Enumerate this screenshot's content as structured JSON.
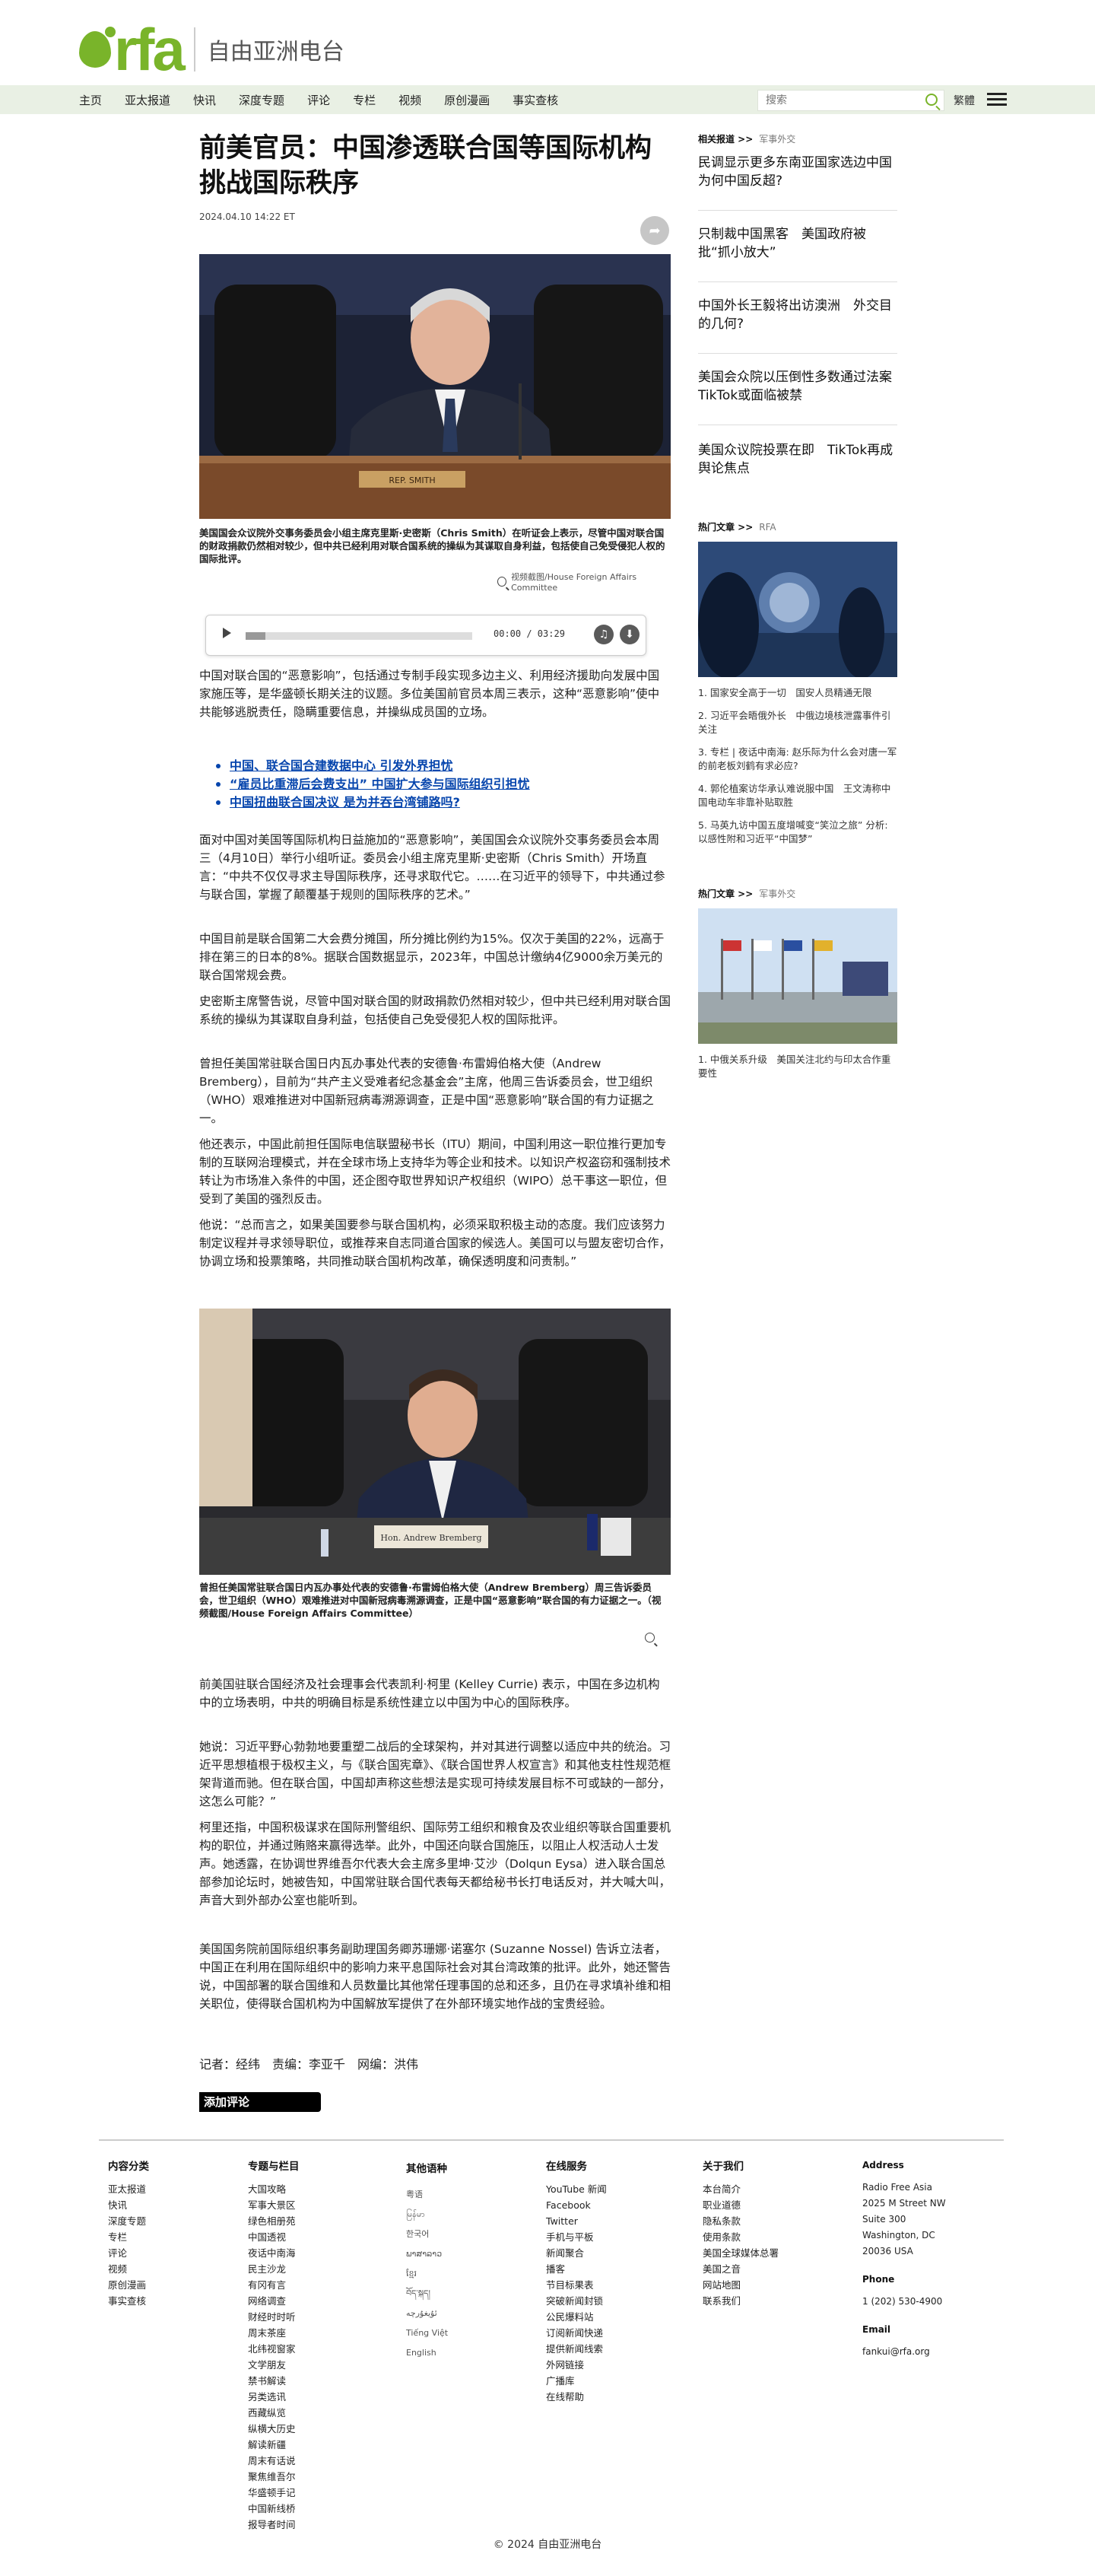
{
  "brand": {
    "logo_text": "rfa",
    "name_cn": "自由亚洲电台",
    "accent": "#79b42a"
  },
  "nav": {
    "items": [
      "主页",
      "亚太报道",
      "快讯",
      "深度专题",
      "评论",
      "专栏",
      "视频",
      "原创漫画",
      "事实查核"
    ],
    "search_placeholder": "搜索",
    "lang_toggle": "繁體"
  },
  "article": {
    "title": "前美官员：中国渗透联合国等国际机构挑战国际秩序",
    "date": "2024.04.10 14:22 ET",
    "photo1": {
      "nameplate": "REP. SMITH",
      "caption": "美国国会众议院外交事务委员会小组主席克里斯·史密斯（Chris Smith）在听证会上表示，尽管中国对联合国的财政捐款仍然相对较少，但中共已经利用对联合国系统的操纵为其谋取自身利益，包括使自己免受侵犯人权的国际批评。",
      "credit": "视频截图/House Foreign Affairs Committee"
    },
    "audio": {
      "time": "00:00 / 03:29"
    },
    "paragraphs1": [
      "中国对联合国的“恶意影响”，包括通过专制手段实现多边主义、利用经济援助向发展中国家施压等，是华盛顿长期关注的议题。多位美国前官员本周三表示，这种“恶意影响”使中共能够逃脱责任，隐瞒重要信息，并操纵成员国的立场。"
    ],
    "related_links": [
      "中国、联合国合建数据中心 引发外界担忧",
      "“雇员比重滞后会费支出” 中国扩大参与国际组织引担忧",
      "中国扭曲联合国决议 是为并吞台湾铺路吗?"
    ],
    "paragraphs2": [
      "面对中国对美国等国际机构日益施加的“恶意影响”，美国国会众议院外交事务委员会本周三（4月10日）举行小组听证。委员会小组主席克里斯·史密斯（Chris Smith）开场直言：“中共不仅仅寻求主导国际秩序，还寻求取代它。……在习近平的领导下，中共通过参与联合国，掌握了颠覆基于规则的国际秩序的艺术。”",
      "中国目前是联合国第二大会费分摊国，所分摊比例约为15%。仅次于美国的22%，远高于排在第三的日本的8%。据联合国数据显示，2023年，中国总计缴纳4亿9000余万美元的联合国常规会费。",
      "史密斯主席警告说，尽管中国对联合国的财政捐款仍然相对较少，但中共已经利用对联合国系统的操纵为其谋取自身利益，包括使自己免受侵犯人权的国际批评。",
      "曾担任美国常驻联合国日内瓦办事处代表的安德鲁·布雷姆伯格大使（Andrew Bremberg），目前为“共产主义受难者纪念基金会”主席，他周三告诉委员会，世卫组织（WHO）艰难推进对中国新冠病毒溯源调查，正是中国“恶意影响”联合国的有力证据之一。",
      "他还表示，中国此前担任国际电信联盟秘书长（ITU）期间，中国利用这一职位推行更加专制的互联网治理模式，并在全球市场上支持华为等企业和技术。以知识产权盗窃和强制技术转让为市场准入条件的中国，还企图夺取世界知识产权组织（WIPO）总干事这一职位，但受到了美国的强烈反击。",
      "他说：“总而言之，如果美国要参与联合国机构，必须采取积极主动的态度。我们应该努力制定议程并寻求领导职位，或推荐来自志同道合国家的候选人。美国可以与盟友密切合作，协调立场和投票策略，共同推动联合国机构改革，确保透明度和问责制。”"
    ],
    "photo2": {
      "nameplate": "Hon. Andrew Bremberg",
      "caption": "曾担任美国常驻联合国日内瓦办事处代表的安德鲁·布雷姆伯格大使（Andrew Bremberg）周三告诉委员会，世卫组织（WHO）艰难推进对中国新冠病毒溯源调查，正是中国“恶意影响”联合国的有力证据之一。（视频截图/House Foreign Affairs Committee）"
    },
    "paragraphs3": [
      "前美国驻联合国经济及社会理事会代表凯利·柯里 (Kelley Currie) 表示，中国在多边机构中的立场表明，中共的明确目标是系统性建立以中国为中心的国际秩序。",
      "她说：习近平野心勃勃地要重塑二战后的全球架构，并对其进行调整以适应中共的统治。习近平思想植根于极权主义，与《联合国宪章》、《联合国世界人权宣言》和其他支柱性规范框架背道而驰。但在联合国，中国却声称这些想法是实现可持续发展目标不可或缺的一部分，这怎么可能？”",
      "柯里还指，中国积极谋求在国际刑警组织、国际劳工组织和粮食及农业组织等联合国重要机构的职位，并通过贿赂来赢得选举。此外，中国还向联合国施压，以阻止人权活动人士发声。她透露，在协调世界维吾尔代表大会主席多里坤·艾沙（Dolqun Eysa）进入联合国总部参加论坛时，她被告知，中国常驻联合国代表每天都给秘书长打电话反对，并大喊大叫，声音大到外部办公室也能听到。",
      "美国国务院前国际组织事务副助理国务卿苏珊娜·诺塞尔 (Suzanne Nossel) 告诉立法者，中国正在利用在国际组织中的影响力来平息国际社会对其台湾政策的批评。此外，她还警告说，中国部署的联合国维和人员数量比其他常任理事国的总和还多，且仍在寻求填补维和相关职位，使得联合国机构为中国解放军提供了在外部环境实地作战的宝贵经验。"
    ],
    "byline": "记者：经纬　责编：李亚千　网编：洪伟",
    "add_comment": "添加评论"
  },
  "sidebar": {
    "related_title": "相关报道 >>",
    "related_sub": "军事外交",
    "related_items": [
      "民调显示更多东南亚国家选边中国　为何中国反超?",
      "只制裁中国黑客　美国政府被批“抓小放大”",
      "中国外长王毅将出访澳洲　外交目的几何?",
      "美国会众院以压倒性多数通过法案　TikTok或面临被禁",
      "美国众议院投票在即　TikTok再成舆论焦点"
    ],
    "hot1_title": "热门文章 >>",
    "hot1_sub": "RFA",
    "hot1_items": [
      "1. 国家安全高于一切　国安人员精通无限",
      "2. 习近平会晤俄外长　中俄边境核泄露事件引关注",
      "3. 专栏 | 夜话中南海: 赵乐际为什么会对唐一军的前老板刘鹤有求必应?",
      "4. 郭伦植案访华承认难说服中国　王文涛称中国电动车非靠补贴取胜",
      "5. 马英九访中国五度增喊变“笑泣之旅” 分析: 以感性附和习近平“中国梦”"
    ],
    "hot2_title": "热门文章 >>",
    "hot2_sub": "军事外交",
    "hot2_items": [
      "1. 中俄关系升级　美国关注北约与印太合作重要性"
    ]
  },
  "footer": {
    "columns": [
      {
        "title": "内容分类",
        "items": [
          "亚太报道",
          "快讯",
          "深度专题",
          "专栏",
          "评论",
          "视频",
          "原创漫画",
          "事实查核"
        ]
      },
      {
        "title": "专题与栏目",
        "items": [
          "大国攻略",
          "军事大景区",
          "绿色相册苑",
          "中国透视",
          "夜话中南海",
          "民主沙龙",
          "有冈有言",
          "网络调查",
          "财经时时听",
          "周末茶座",
          "北纬视窗家",
          "文学朋友",
          "禁书解读",
          "另类选讯",
          "西藏纵览",
          "纵横大历史",
          "解读新疆",
          "周末有话说",
          "聚焦维吾尔",
          "华盛顿手记",
          "中国新线桥",
          "报导者时间"
        ]
      },
      {
        "title": "其他语种",
        "items": [
          "粤语",
          "မြန်မာ",
          "한국어",
          "ພາສາລາວ",
          "ខ្មែរ",
          "བོད་སྐད།",
          "ئۇيغۇرچە",
          "Tiếng Việt",
          "English"
        ]
      },
      {
        "title": "在线服务",
        "items": [
          "YouTube 新闻",
          "Facebook",
          "Twitter",
          "手机与平板",
          "新闻聚合",
          "播客",
          "节目标果表",
          "突破新闻封锁",
          "公民爆料站",
          "订阅新闻快递",
          "提供新闻线索",
          "外网链接",
          "广播库",
          "在线帮助"
        ]
      },
      {
        "title": "关于我们",
        "items": [
          "本台简介",
          "职业道德",
          "隐私条款",
          "使用条款",
          "美国全球媒体总署",
          "美国之音",
          "网站地图",
          "联系我们"
        ]
      }
    ],
    "address_title": "Address",
    "address_lines": [
      "Radio Free Asia",
      "2025 M Street NW",
      "Suite 300",
      "Washington, DC",
      "20036 USA"
    ],
    "phone_title": "Phone",
    "phone": "1 (202) 530-4900",
    "email_title": "Email",
    "email": "fankui@rfa.org",
    "copyright": "© 2024 自由亚洲电台"
  }
}
